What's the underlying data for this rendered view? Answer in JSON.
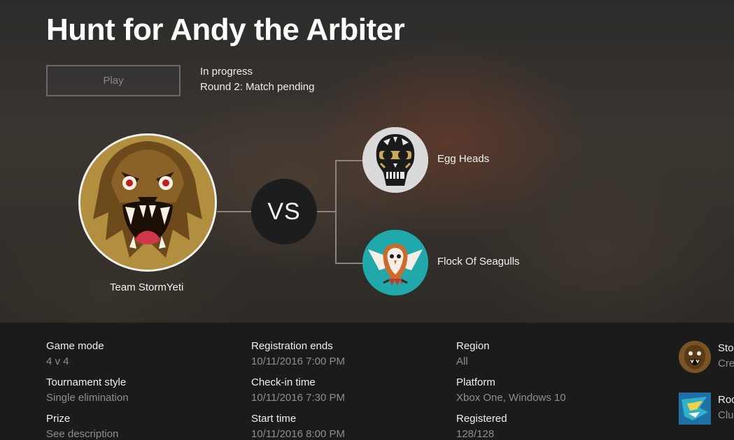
{
  "tournament": {
    "title": "Hunt for Andy the Arbiter",
    "play_label": "Play",
    "status": "In progress",
    "round": "Round 2: Match pending"
  },
  "match": {
    "team": "Team StormYeti",
    "vs_label": "VS",
    "opponents": [
      "Egg Heads",
      "Flock Of Seagulls"
    ]
  },
  "details": {
    "game_mode": {
      "label": "Game mode",
      "value": "4 v 4"
    },
    "tournament_style": {
      "label": "Tournament style",
      "value": "Single elimination"
    },
    "prize": {
      "label": "Prize",
      "value": "See description"
    },
    "registration_ends": {
      "label": "Registration ends",
      "value": "10/11/2016 7:00 PM"
    },
    "check_in_time": {
      "label": "Check-in time",
      "value": "10/11/2016 7:30 PM"
    },
    "start_time": {
      "label": "Start time",
      "value": "10/11/2016 8:00 PM"
    },
    "region": {
      "label": "Region",
      "value": "All"
    },
    "platform": {
      "label": "Platform",
      "value": "Xbox One, Windows 10"
    },
    "registered": {
      "label": "Registered",
      "value": "128/128"
    }
  },
  "side_panel": [
    {
      "name": "Sto",
      "sub": "Cre",
      "icon": "bear-icon"
    },
    {
      "name": "Roc",
      "sub": "Clu",
      "icon": "club-logo-icon"
    }
  ]
}
